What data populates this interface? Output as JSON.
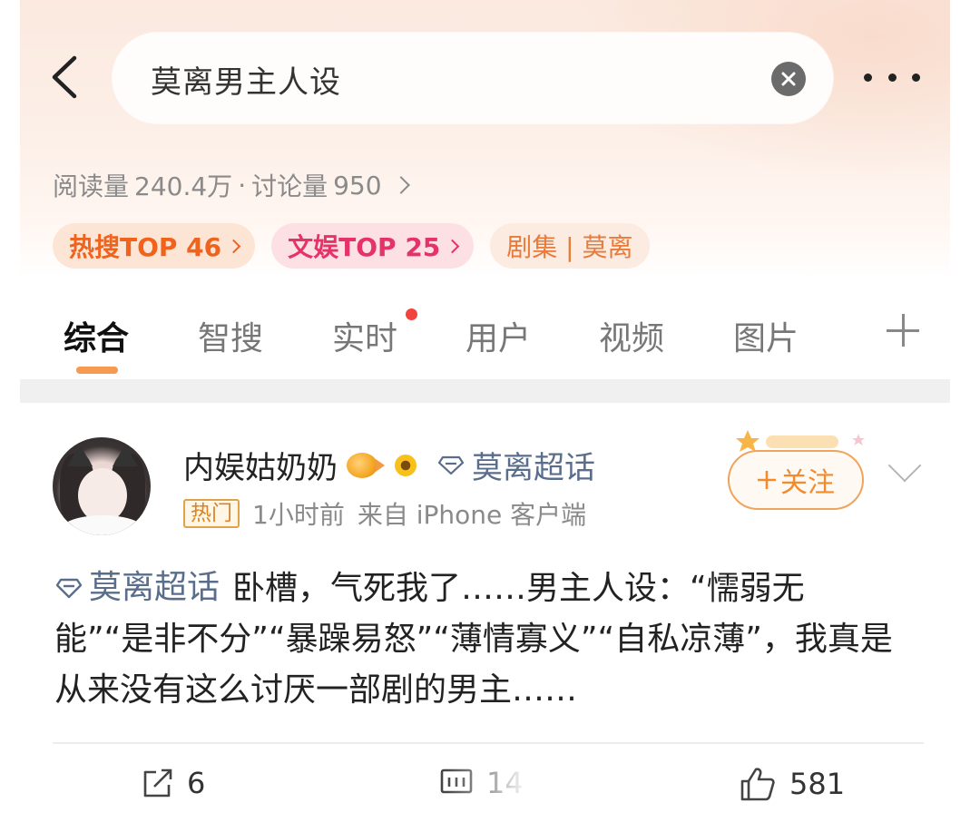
{
  "header": {
    "search_query": "莫离男主人设",
    "stats_reads_label": "阅读量",
    "stats_reads_value": "240.4万",
    "stats_separator": "·",
    "stats_discuss_label": "讨论量",
    "stats_discuss_value": "950",
    "tags": [
      {
        "label": "热搜TOP 46"
      },
      {
        "label": "文娱TOP 25"
      },
      {
        "label": "剧集 | 莫离"
      }
    ]
  },
  "tabs": [
    {
      "label": "综合",
      "active": true
    },
    {
      "label": "智搜"
    },
    {
      "label": "实时",
      "has_dot": true
    },
    {
      "label": "用户"
    },
    {
      "label": "视频"
    },
    {
      "label": "图片"
    }
  ],
  "post": {
    "username": "内娱姑奶奶",
    "topic_name": "莫离超话",
    "badge": "热门",
    "time": "1小时前",
    "source": "来自 iPhone 客户端",
    "follow_label": "关注",
    "content_topic": "莫离超话",
    "content_text": "卧槽，气死我了……男主人设：“懦弱无能”“是非不分”“暴躁易怒”“薄情寡义”“自私凉薄”，我真是从来没有这么讨厌一部剧的男主……",
    "actions": {
      "repost_count": "6",
      "comment_count": "14",
      "like_count": "581"
    }
  },
  "colors": {
    "accent_orange": "#f28b2c",
    "topic_blue": "#5a6e8c",
    "hot_tag": "#f0631d",
    "ent_tag": "#e5336a"
  },
  "icons": [
    "back-icon",
    "clear-icon",
    "more-icon",
    "chevron-right-icon",
    "plus-icon",
    "diamond-topic-icon",
    "chevron-down-icon",
    "repost-icon",
    "comment-icon",
    "like-icon"
  ]
}
